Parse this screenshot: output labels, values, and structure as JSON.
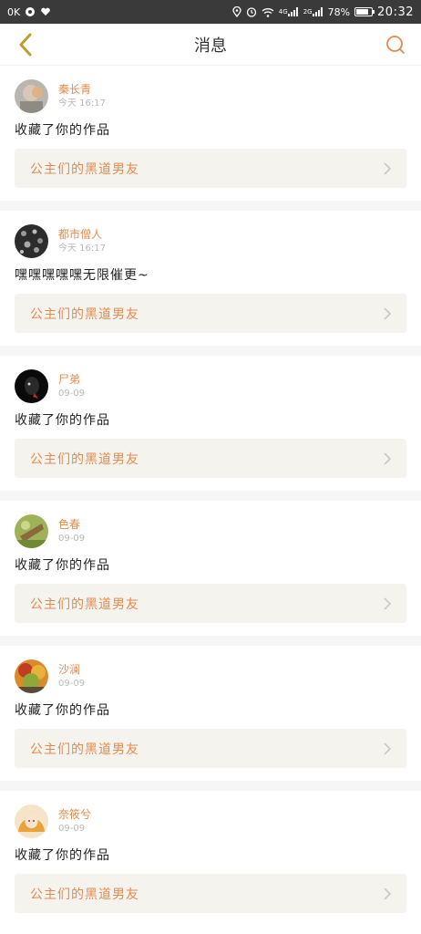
{
  "status_bar": {
    "left_text": "0K",
    "network_4g": "4G",
    "network_2g": "2G",
    "battery_percent": "78%",
    "battery_level": 0.78,
    "time": "20:32"
  },
  "header": {
    "title": "消息",
    "back_icon": "chevron-left-icon",
    "search_icon": "search-icon"
  },
  "colors": {
    "accent": "#e58a4e",
    "card_bg": "#f4f3ee",
    "status_bar": "#3a3a3a"
  },
  "messages": [
    {
      "username": "秦长青",
      "time": "今天 16:17",
      "text": "收藏了你的作品",
      "work": "公主们的黑道男友"
    },
    {
      "username": "都市僧人",
      "time": "今天 16:17",
      "text": "嘿嘿嘿嘿嘿无限催更~",
      "work": "公主们的黑道男友"
    },
    {
      "username": "尸弟",
      "time": "09-09",
      "text": "收藏了你的作品",
      "work": "公主们的黑道男友"
    },
    {
      "username": "色春",
      "time": "09-09",
      "text": "收藏了你的作品",
      "work": "公主们的黑道男友"
    },
    {
      "username": "沙澜",
      "time": "09-09",
      "text": "收藏了你的作品",
      "work": "公主们的黑道男友"
    },
    {
      "username": "奈筱兮",
      "time": "09-09",
      "text": "收藏了你的作品",
      "work": "公主们的黑道男友"
    }
  ]
}
